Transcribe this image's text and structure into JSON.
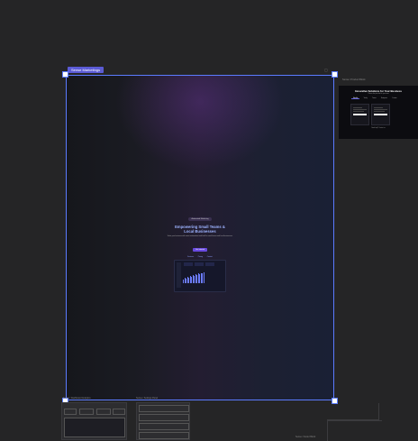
{
  "frame_tag": {
    "label": "Sense Marketings",
    "tools": "⋯ ✧",
    "right": "▢"
  },
  "hero": {
    "badge": "Automated Marketing",
    "title_line1": "Empowering Small Teams &",
    "title_line2": "Local Businesses",
    "subtitle": "Scale your business with smart automation tools built for small teams and local businesses.",
    "cta": "Get started",
    "links": [
      "Features",
      "Pricing",
      "Contact"
    ]
  },
  "dashboard": {
    "bar_values": [
      0.3,
      0.45,
      0.38,
      0.55,
      0.5,
      0.62,
      0.58,
      0.7,
      0.66,
      0.78,
      0.72,
      0.85,
      0.8,
      0.92,
      0.88,
      1.0
    ]
  },
  "right_frame": {
    "label": "Sense / Product Block",
    "title": "Innovative Solutions for Your Business",
    "subtitle": "Choose the plan that fits your team",
    "tabs": [
      "Monthly",
      "Yearly",
      "Teams",
      "Enterprise",
      "Custom"
    ],
    "footer": "Need help? Contact us"
  },
  "bottom_frames": [
    {
      "label": "Sense / Dashboard Analytics"
    },
    {
      "label": "Sense / Settings Panel"
    }
  ],
  "bottom_right_label": "Sense / Footer Block",
  "colors": {
    "accent": "#5b7bff",
    "tag": "#5b5bd6",
    "canvas": "#252526"
  }
}
